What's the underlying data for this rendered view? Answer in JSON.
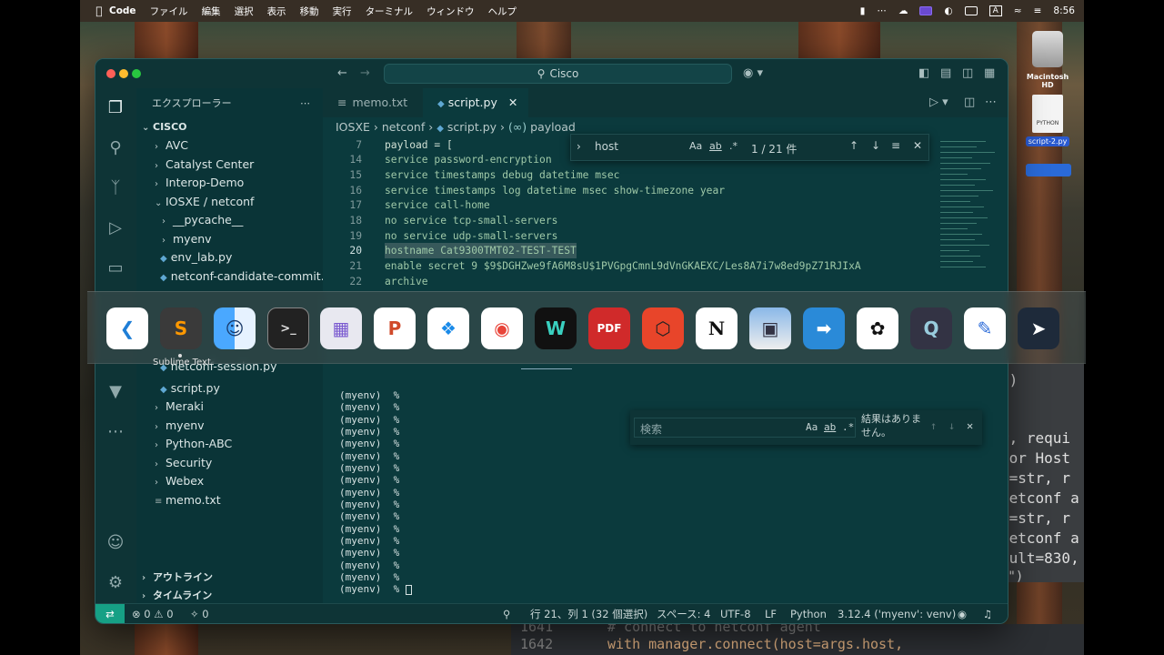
{
  "menubar": {
    "app": "Code",
    "items": [
      "ファイル",
      "編集",
      "選択",
      "表示",
      "移動",
      "実行",
      "ターミナル",
      "ウィンドウ",
      "ヘルプ"
    ],
    "input_indicator": "A",
    "clock": "8:56"
  },
  "desktop": {
    "disk_label": "Macintosh HD",
    "file_label": "script-2.py",
    "file_badge": "PYTHON"
  },
  "window": {
    "search_text": "Cisco",
    "sidebar": {
      "title": "エクスプローラー",
      "root": "CISCO",
      "items": [
        "AVC",
        "Catalyst Center",
        "Interop-Demo",
        "IOSXE / netconf",
        "__pycache__",
        "myenv",
        "env_lab.py",
        "netconf-candidate-commit....",
        "netconf-session.py",
        "script.py",
        "Meraki",
        "myenv",
        "Python-ABC",
        "Security",
        "Webex",
        "memo.txt"
      ],
      "outline": "アウトライン",
      "timeline": "タイムライン"
    },
    "tabs": [
      "memo.txt",
      "script.py"
    ],
    "breadcrumb": [
      "IOSXE",
      "netconf",
      "script.py",
      "payload"
    ],
    "code_lines": [
      {
        "n": "7",
        "t": "payload = ["
      },
      {
        "n": "14",
        "t": "service password-encryption"
      },
      {
        "n": "15",
        "t": "service timestamps debug datetime msec"
      },
      {
        "n": "16",
        "t": "service timestamps log datetime msec show-timezone year"
      },
      {
        "n": "17",
        "t": "service call-home"
      },
      {
        "n": "18",
        "t": "no service tcp-small-servers"
      },
      {
        "n": "19",
        "t": "no service udp-small-servers"
      },
      {
        "n": "20",
        "t": "hostname Cat9300TMT02-TEST-TEST"
      },
      {
        "n": "21",
        "t": "enable secret 9 $9$DGHZwe9fA6M8sU$1PVGpgCmnL9dVnGKAEXC/Les8A7i7w8ed9pZ71RJIxA"
      },
      {
        "n": "22",
        "t": "archive"
      }
    ],
    "find": {
      "query": "host",
      "opt_case": "Aa",
      "opt_word": "ab",
      "opt_regex": ".*",
      "result": "1 / 21 件"
    },
    "terminal": {
      "prompt": "(myenv)  %",
      "search_placeholder": "検索",
      "no_results": "結果はありません。",
      "opt_case": "Aa",
      "opt_word": "ab",
      "opt_regex": ".*"
    },
    "status": {
      "errors": "0",
      "warnings": "0",
      "ports": "0",
      "position": "行 21、列 1 (32 個選択)",
      "spaces": "スペース: 4",
      "encoding": "UTF-8",
      "eol": "LF",
      "language": "Python",
      "interpreter": "3.12.4 ('myenv': venv)"
    }
  },
  "dock": {
    "hover_label": "Sublime Text",
    "apps": [
      "vscode",
      "sublime-text",
      "finder",
      "terminal",
      "launchpad",
      "powerpoint",
      "safari",
      "chrome",
      "webex",
      "pdf-app",
      "davinci",
      "notion",
      "preview",
      "remote-desktop",
      "chatgpt",
      "quicktime",
      "freeform",
      "shortcut-app"
    ]
  },
  "background_code": {
    "right_fragments": [
      "\")",
      "r, requi",
      " or Host",
      "e=str, r",
      "netconf a",
      "e=str, r",
      "netconf a",
      "ault=830,",
      "t\")"
    ],
    "bottom_lines": [
      {
        "n": "1641",
        "t": "# connect to netconf agent"
      },
      {
        "n": "1642",
        "t": "with manager.connect(host=args.host,"
      }
    ]
  }
}
